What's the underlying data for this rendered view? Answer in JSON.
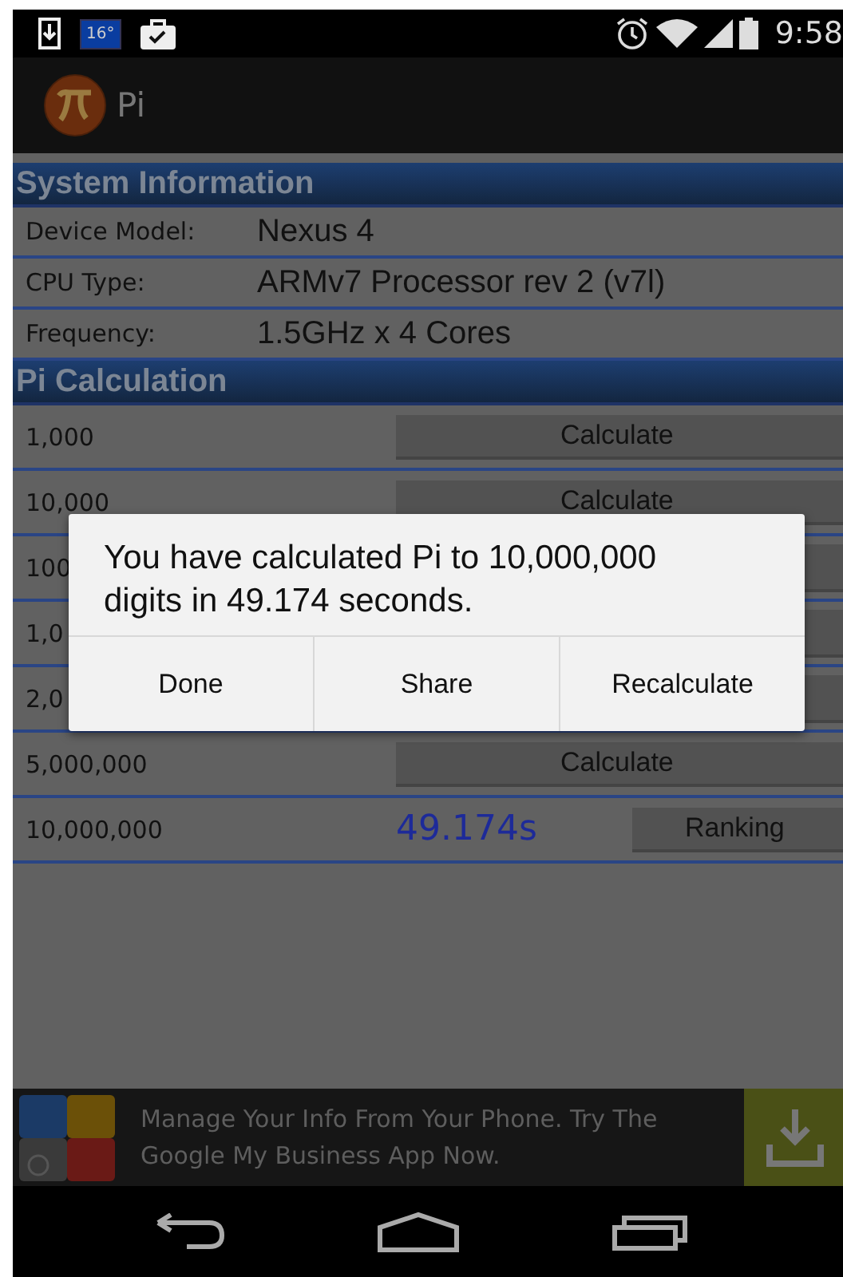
{
  "status_bar": {
    "temperature": "16°",
    "time": "9:58"
  },
  "app_bar": {
    "title": "Pi"
  },
  "system_information": {
    "title": "System Information",
    "rows": [
      {
        "label": "Device Model:",
        "value": "Nexus 4"
      },
      {
        "label": "CPU Type:",
        "value": "ARMv7 Processor rev 2 (v7l)"
      },
      {
        "label": "Frequency:",
        "value": "1.5GHz x 4 Cores"
      }
    ]
  },
  "pi_calculation": {
    "title": "Pi Calculation",
    "rows": [
      {
        "kind": "calculate",
        "digits": "1,000",
        "button": "Calculate"
      },
      {
        "kind": "calculate",
        "digits": "10,000",
        "button": "Calculate"
      },
      {
        "kind": "covered",
        "digits": "100"
      },
      {
        "kind": "covered",
        "digits": "1,0"
      },
      {
        "kind": "covered",
        "digits": "2,0"
      },
      {
        "kind": "calculate",
        "digits": "5,000,000",
        "button": "Calculate"
      },
      {
        "kind": "result",
        "digits": "10,000,000",
        "result": "49.174s",
        "button": "Ranking"
      }
    ]
  },
  "dialog": {
    "message": "You have calculated Pi to 10,000,000 digits in 49.174 seconds.",
    "buttons": [
      "Done",
      "Share",
      "Recalculate"
    ]
  },
  "ad_banner": {
    "text": "Manage Your Info From Your Phone. Try The Google My Business App Now."
  }
}
